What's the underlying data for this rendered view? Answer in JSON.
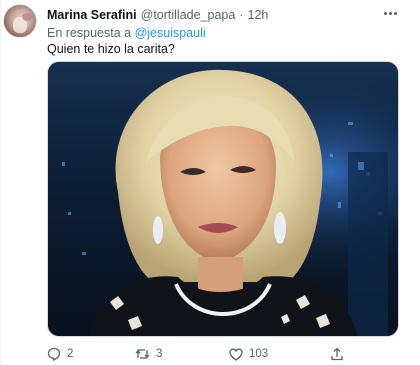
{
  "tweet": {
    "author_name": "Marina Serafini",
    "handle": "@tortillade_papa",
    "separator": "·",
    "time": "12h",
    "reply_prefix": "En respuesta a",
    "reply_to": "@jesuispauli",
    "text": "Quien te hizo la carita?"
  },
  "actions": {
    "reply_count": "2",
    "retweet_count": "3",
    "like_count": "103"
  },
  "icons": {
    "avatar": "avatar-image",
    "more": "more-options-icon",
    "reply": "reply-icon",
    "retweet": "retweet-icon",
    "like": "heart-icon",
    "share": "share-icon"
  },
  "colors": {
    "text": "#0f1419",
    "secondary": "#536471",
    "link": "#1d9bf0"
  }
}
